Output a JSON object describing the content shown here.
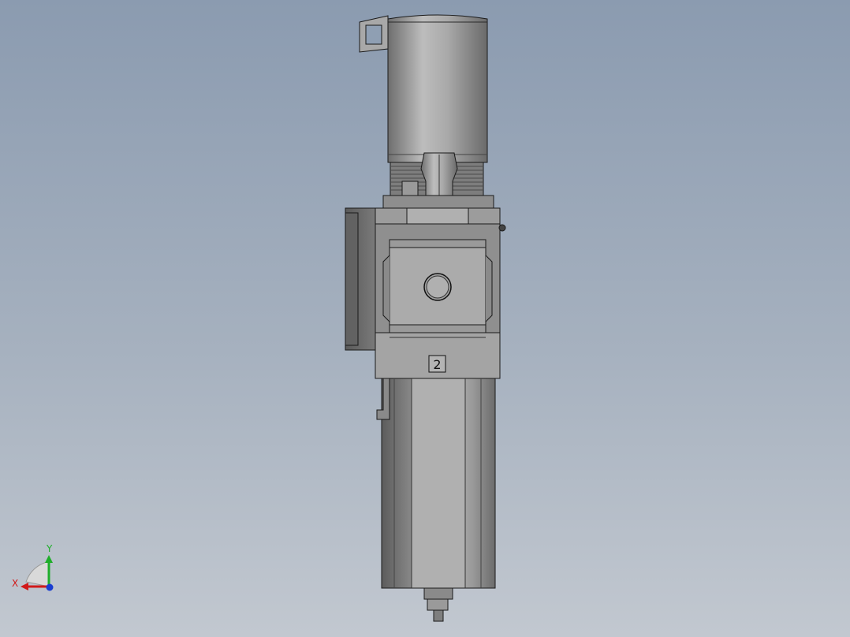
{
  "model": {
    "port_marking": "2"
  },
  "triad": {
    "x_label": "X",
    "y_label": "Y",
    "x_color": "#d11a1a",
    "y_color": "#1fae2a",
    "z_color": "#1a3ed1"
  },
  "colors": {
    "background_top": "#8b9bb0",
    "background_bottom": "#c2c8d0",
    "part_mid": "#a3a3a3",
    "part_light": "#b8b8b8",
    "part_dark": "#6f6f6f",
    "edge": "#1a1a1a"
  }
}
